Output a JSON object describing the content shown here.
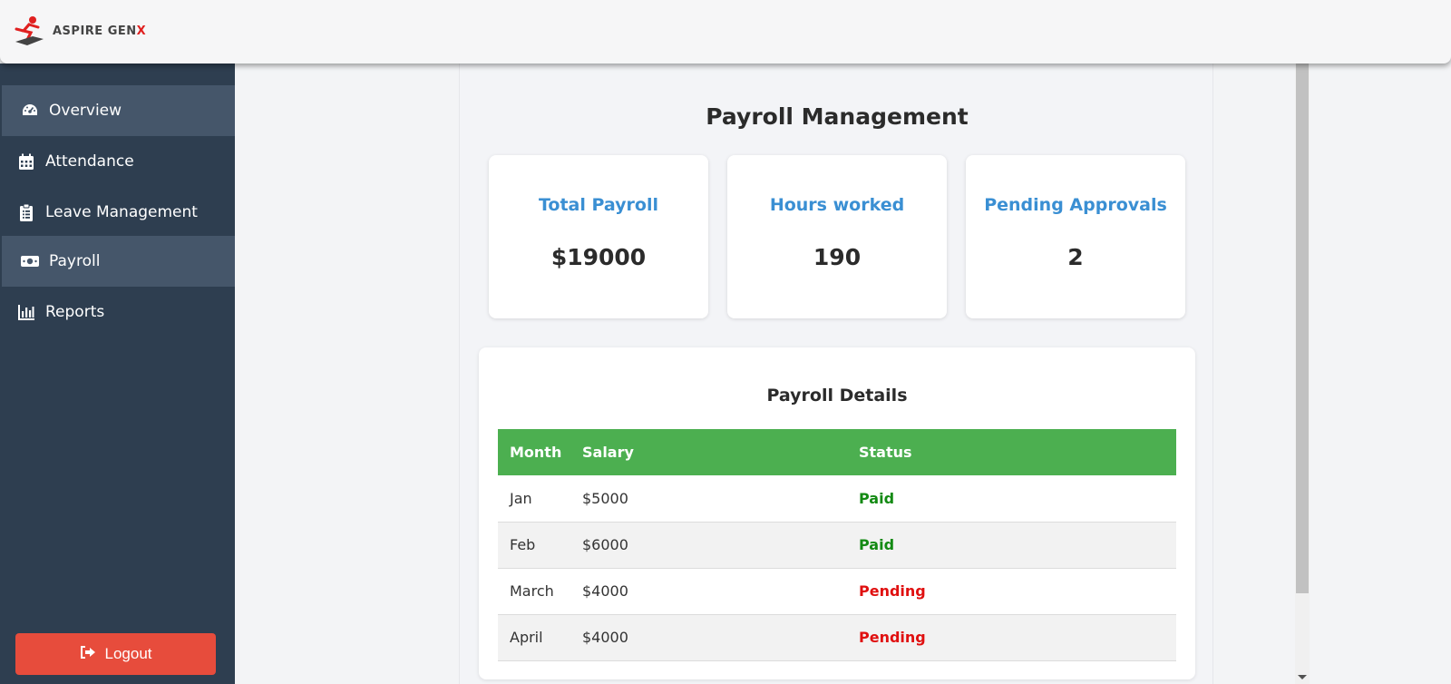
{
  "brand": {
    "name_prefix": "ASPIRE GEN",
    "name_accent": "X"
  },
  "sidebar": {
    "items": [
      {
        "label": "Overview",
        "icon": "dashboard-gauge-icon",
        "active": true
      },
      {
        "label": "Attendance",
        "icon": "calendar-icon",
        "active": false
      },
      {
        "label": "Leave Management",
        "icon": "clipboard-icon",
        "active": false
      },
      {
        "label": "Payroll",
        "icon": "money-bill-icon",
        "active": true
      },
      {
        "label": "Reports",
        "icon": "bar-chart-icon",
        "active": false
      }
    ],
    "logout_label": "Logout"
  },
  "main": {
    "title": "Payroll Management",
    "cards": [
      {
        "label": "Total Payroll",
        "value": "$19000"
      },
      {
        "label": "Hours worked",
        "value": "190"
      },
      {
        "label": "Pending Approvals",
        "value": "2"
      }
    ],
    "details": {
      "title": "Payroll Details",
      "columns": [
        "Month",
        "Salary",
        "Status"
      ],
      "rows": [
        {
          "month": "Jan",
          "salary": "$5000",
          "status": "Paid"
        },
        {
          "month": "Feb",
          "salary": "$6000",
          "status": "Paid"
        },
        {
          "month": "March",
          "salary": "$4000",
          "status": "Pending"
        },
        {
          "month": "April",
          "salary": "$4000",
          "status": "Pending"
        }
      ]
    }
  },
  "colors": {
    "sidebar_bg": "#2e3e50",
    "active_item_bg": "#45566a",
    "logout_bg": "#e74c3c",
    "table_header_bg": "#4caf50",
    "card_label": "#3a8fd3",
    "paid": "#138a13",
    "pending": "#e01010"
  }
}
